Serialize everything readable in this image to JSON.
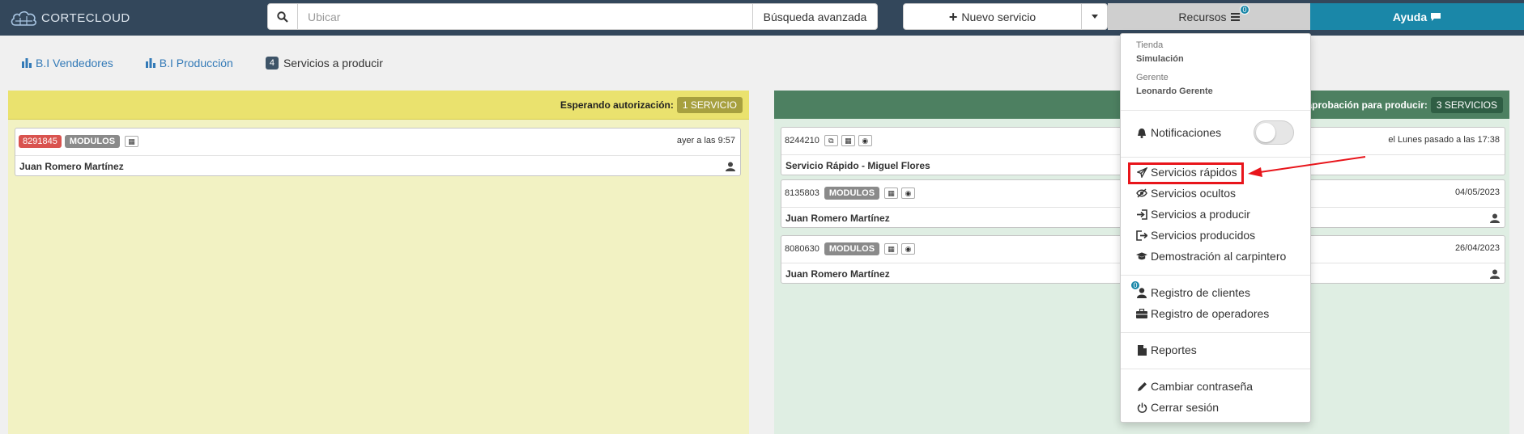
{
  "brand": {
    "name": "CORTECLOUD"
  },
  "colors": {
    "navbar": "#33475b",
    "help": "#1a87a8",
    "waiting_panel": "#eae26e",
    "approved_panel": "#4d8061",
    "highlight": "#e8151b"
  },
  "search": {
    "placeholder": "Ubicar",
    "value": "",
    "icon": "search-icon",
    "advanced_label": "Búsqueda avanzada"
  },
  "toolbar": {
    "new_service_label": "Nuevo servicio",
    "resources_label": "Recursos",
    "resources_count": "0",
    "help_label": "Ayuda"
  },
  "tabs": [
    {
      "label": "B.I Vendedores",
      "icon": "bar-chart-icon"
    },
    {
      "label": "B.I Producción",
      "icon": "bar-chart-icon"
    },
    {
      "label": "Servicios a producir",
      "count": "4"
    }
  ],
  "panels": {
    "waiting": {
      "title": "Esperando autorización:",
      "badge": "1 SERVICIO",
      "cards": [
        {
          "code": "8291845",
          "tag": "MODULOS",
          "date": "ayer a las 9:57",
          "client": "Juan Romero Martínez"
        }
      ]
    },
    "approved": {
      "title": "aprobación para producir:",
      "badge": "3 SERVICIOS",
      "cards": [
        {
          "code": "8244210",
          "tag": "",
          "date": "el Lunes pasado a las 17:38",
          "client": "Servicio Rápido - Miguel Flores"
        },
        {
          "code": "8135803",
          "tag": "MODULOS",
          "date": "04/05/2023",
          "client": "Juan Romero Martínez"
        },
        {
          "code": "8080630",
          "tag": "MODULOS",
          "date": "26/04/2023",
          "client": "Juan Romero Martínez"
        }
      ]
    }
  },
  "resources_menu": {
    "store_label": "Tienda",
    "store_value": "Simulación",
    "manager_label": "Gerente",
    "manager_value": "Leonardo Gerente",
    "notifications": "Notificaciones",
    "notifications_enabled": false,
    "items": [
      {
        "label": "Servicios rápidos",
        "icon": "paper-plane-icon"
      },
      {
        "label": "Servicios ocultos",
        "icon": "eye-slash-icon"
      },
      {
        "label": "Servicios a producir",
        "icon": "sign-in-icon"
      },
      {
        "label": "Servicios producidos",
        "icon": "sign-out-icon"
      },
      {
        "label": "Demostración al carpintero",
        "icon": "graduation-cap-icon"
      },
      {
        "label": "Registro de clientes",
        "icon": "user-icon",
        "count": "0"
      },
      {
        "label": "Registro de operadores",
        "icon": "briefcase-icon"
      },
      {
        "label": "Reportes",
        "icon": "file-icon"
      },
      {
        "label": "Cambiar contraseña",
        "icon": "pencil-icon"
      },
      {
        "label": "Cerrar sesión",
        "icon": "power-icon"
      }
    ]
  }
}
